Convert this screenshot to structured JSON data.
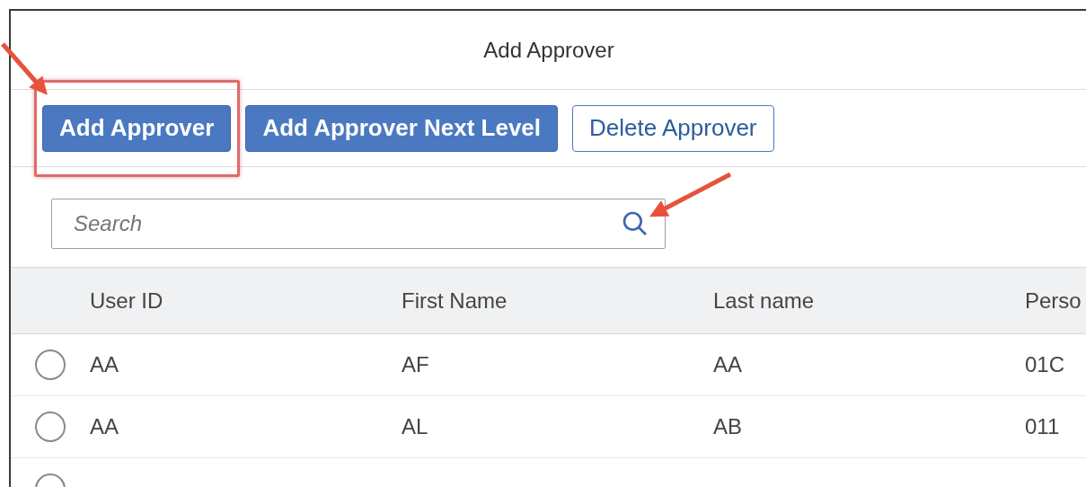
{
  "dialog": {
    "title": "Add Approver"
  },
  "toolbar": {
    "buttons": [
      {
        "label": "Add Approver",
        "kind": "emphasized",
        "highlighted": true,
        "arrow": true
      },
      {
        "label": "Add Approver Next Level",
        "kind": "emphasized",
        "highlighted": false,
        "arrow": false
      },
      {
        "label": "Delete Approver",
        "kind": "default",
        "highlighted": false,
        "arrow": false
      }
    ]
  },
  "search": {
    "placeholder": "Search",
    "arrow": true
  },
  "table": {
    "columns": [
      "User ID",
      "First Name",
      "Last name",
      "Perso"
    ],
    "rows": [
      {
        "selected": false,
        "cells": [
          "AA",
          "AF",
          "AA",
          "01C"
        ]
      },
      {
        "selected": false,
        "cells": [
          "AA",
          "AL",
          "AB",
          "011"
        ]
      },
      {
        "selected": false
      }
    ]
  }
}
